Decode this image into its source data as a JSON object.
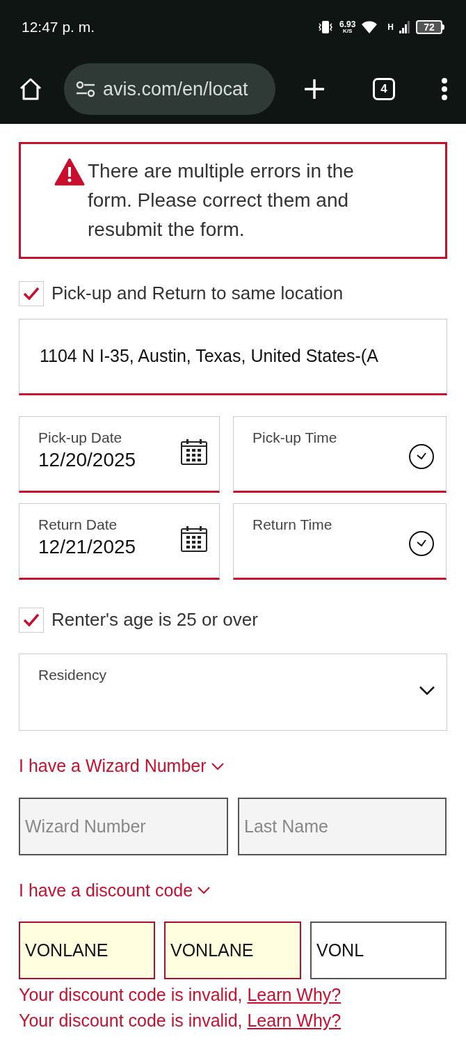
{
  "status_bar": {
    "time": "12:47 p. m.",
    "net_speed": "6.93",
    "net_unit": "K/S",
    "network_type": "H",
    "battery": "72"
  },
  "browser": {
    "url": "avis.com/en/locat",
    "tab_count": "4"
  },
  "error_banner": {
    "text": "There are multiple errors in the form. Please correct them and resubmit the form."
  },
  "same_location": {
    "label": "Pick-up and Return to same location",
    "checked": true
  },
  "location_field": {
    "value": "1104 N I-35, Austin, Texas, United States-(A",
    "error": true
  },
  "date_fields": [
    {
      "kind": "date",
      "label": "Pick-up Date",
      "value": "12/20/2025",
      "error": true
    },
    {
      "kind": "time",
      "label": "Pick-up Time",
      "error": true
    },
    {
      "kind": "date",
      "label": "Return Date",
      "value": "12/21/2025",
      "error": true
    },
    {
      "kind": "time",
      "label": "Return Time",
      "error": true
    }
  ],
  "age_checkbox": {
    "label": "Renter's age is 25 or over",
    "checked": true
  },
  "residency": {
    "label": "Residency"
  },
  "wizard": {
    "toggle": "I have a Wizard Number",
    "fields": [
      {
        "placeholder": "Wizard Number"
      },
      {
        "placeholder": "Last Name"
      }
    ]
  },
  "discount": {
    "toggle": "I have a discount code",
    "fields": [
      {
        "value": "VONLANE",
        "invalid": true
      },
      {
        "value": "VONLANE",
        "invalid": true
      },
      {
        "value": "VONL",
        "invalid": false
      }
    ],
    "errors": [
      {
        "text": "Your discount code is invalid,",
        "link": "Learn Why?"
      },
      {
        "text": "Your discount code is invalid,",
        "link": "Learn Why?"
      }
    ]
  }
}
